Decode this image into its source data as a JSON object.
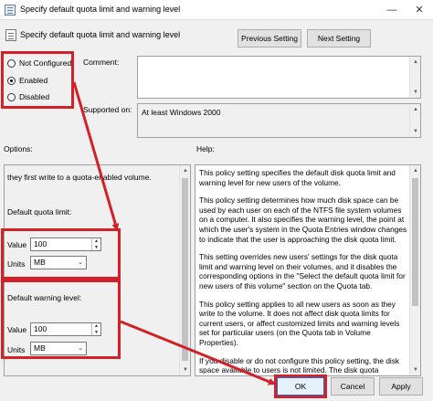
{
  "window": {
    "title": "Specify default quota limit and warning level",
    "minimize_glyph": "—",
    "close_glyph": "✕"
  },
  "header": {
    "title": "Specify default quota limit and warning level",
    "prev_button": "Previous Setting",
    "next_button": "Next Setting"
  },
  "state": {
    "options": [
      "Not Configured",
      "Enabled",
      "Disabled"
    ],
    "selected": "Enabled"
  },
  "comment": {
    "label": "Comment:",
    "value": ""
  },
  "supported": {
    "label": "Supported on:",
    "value": "At least Windows 2000"
  },
  "options_pane": {
    "label": "Options:",
    "intro": "they first write to a quota-enabled volume.",
    "quota_limit_label": "Default quota limit:",
    "limit_value_label": "Value",
    "limit_value": "100",
    "limit_units_label": "Units",
    "limit_units": "MB",
    "warning_label": "Default warning level:",
    "warning_value_label": "Value",
    "warning_value": "100",
    "warning_units_label": "Units",
    "warning_units": "MB"
  },
  "help_pane": {
    "label": "Help:",
    "paragraphs": [
      "This policy setting specifies the default disk quota limit and warning level for new users of the volume.",
      "This policy setting determines how much disk space can be used by each user on each of the NTFS file system volumes on a computer. It also specifies the warning level, the point at which the user's system in the Quota Entries window changes to indicate that the user is approaching the disk quota limit.",
      "This setting overrides new users' settings for the disk quota limit and warning level on their volumes, and it disables the corresponding options in the \"Select the default quota limit for new users of this volume\" section on the Quota tab.",
      "This policy setting applies to all new users as soon as they write to the volume. It does not affect disk quota limits for current users, or affect customized limits and warning levels set for particular users (on the Quota tab in Volume Properties).",
      "If you disable or do not configure this policy setting, the disk space available to users is not limited. The disk quota"
    ]
  },
  "footer": {
    "ok": "OK",
    "cancel": "Cancel",
    "apply": "Apply"
  },
  "colors": {
    "highlight": "#d42027",
    "accent": "#0078d7"
  }
}
